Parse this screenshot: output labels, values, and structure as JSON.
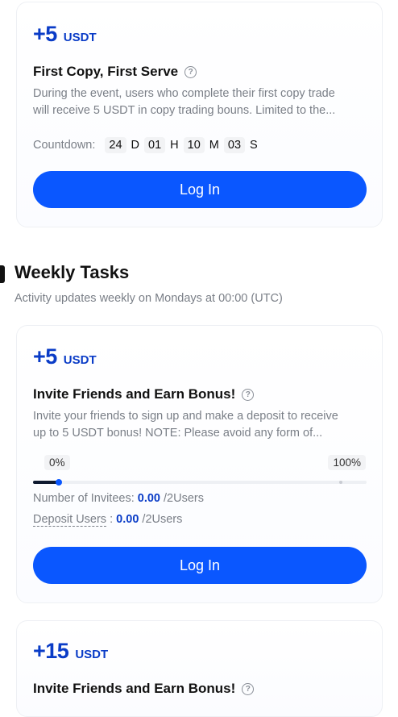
{
  "colors": {
    "primary": "#0a57ff",
    "accent_text": "#0a3cc7",
    "muted": "#7a7f87"
  },
  "card1": {
    "reward_amount": "+5",
    "reward_unit": "USDT",
    "title": "First Copy, First Serve",
    "help_icon": "question-circle-icon",
    "description_line1": "During the event, users who complete their first copy trade",
    "description_line2": "will receive 5 USDT in copy trading bouns. Limited to the...",
    "countdown_label": "Countdown:",
    "countdown": {
      "days": "24",
      "d": "D",
      "hours": "01",
      "h": "H",
      "minutes": "10",
      "m": "M",
      "seconds": "03",
      "s": "S"
    },
    "button": "Log In"
  },
  "weekly": {
    "title": "Weekly Tasks",
    "subtitle": "Activity updates weekly on Mondays at 00:00 (UTC)"
  },
  "card2": {
    "reward_amount": "+5",
    "reward_unit": "USDT",
    "title": "Invite Friends and Earn Bonus!",
    "help_icon": "question-circle-icon",
    "description_line1": "Invite your friends to sign up and make a deposit to receive",
    "description_line2": "up to 5 USDT bonus! NOTE: Please avoid any form of...",
    "progress_min_label": "0%",
    "progress_max_label": "100%",
    "progress_fraction": 0.0,
    "invitees_label": "Number of Invitees:",
    "invitees_value": "0.00",
    "invitees_suffix": "/2Users",
    "deposit_label": "Deposit Users",
    "deposit_sep": ":",
    "deposit_value": "0.00",
    "deposit_suffix": "/2Users",
    "button": "Log In"
  },
  "card3": {
    "reward_amount": "+15",
    "reward_unit": "USDT",
    "title": "Invite Friends and Earn Bonus!",
    "help_icon": "question-circle-icon"
  }
}
